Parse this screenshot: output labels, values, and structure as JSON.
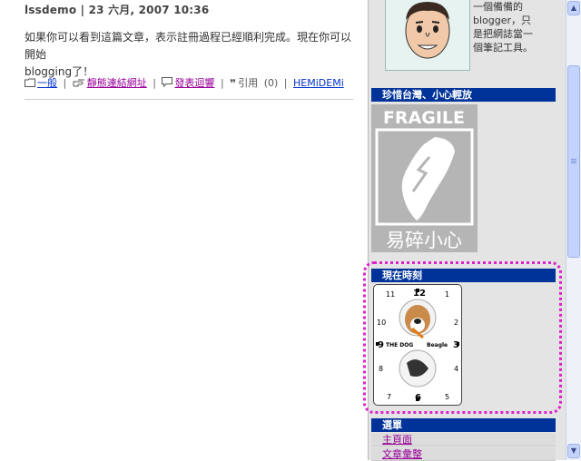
{
  "post": {
    "title": "lssdemo | 23 六月, 2007 10:36",
    "body_line1": "如果你可以看到這篇文章，表示註冊過程已經順利完成。現在你可以開始",
    "body_line2": "blogging了！",
    "footer": {
      "category": "一般",
      "permalink": "靜態連結網址",
      "comment": "發表迴響",
      "trackback_label": "引用",
      "trackback_count": "(0)",
      "author": "HEMiDEMi"
    }
  },
  "sidebar": {
    "about_lines": [
      "一個備備的",
      "blogger，只",
      "是把網誌當一",
      "個筆記工具。"
    ],
    "section_taiwan": "珍惜台灣、小心輕放",
    "fragile_word": "FRAGILE",
    "fragile_cn": "易碎小心",
    "section_clock": "現在時刻",
    "clock": {
      "numbers": [
        "12",
        "1",
        "2",
        "3",
        "4",
        "5",
        "6",
        "7",
        "8",
        "9",
        "10",
        "11"
      ],
      "brand": "THE DOG",
      "breed": "Beagle"
    },
    "section_menu": "選單",
    "menu_items": [
      "主頁面",
      "文章彙整"
    ]
  },
  "colors": {
    "section_header_bg": "#003399",
    "link_purple": "#990099",
    "link_blue": "#0033cc",
    "highlight_border": "#dd22cc"
  }
}
